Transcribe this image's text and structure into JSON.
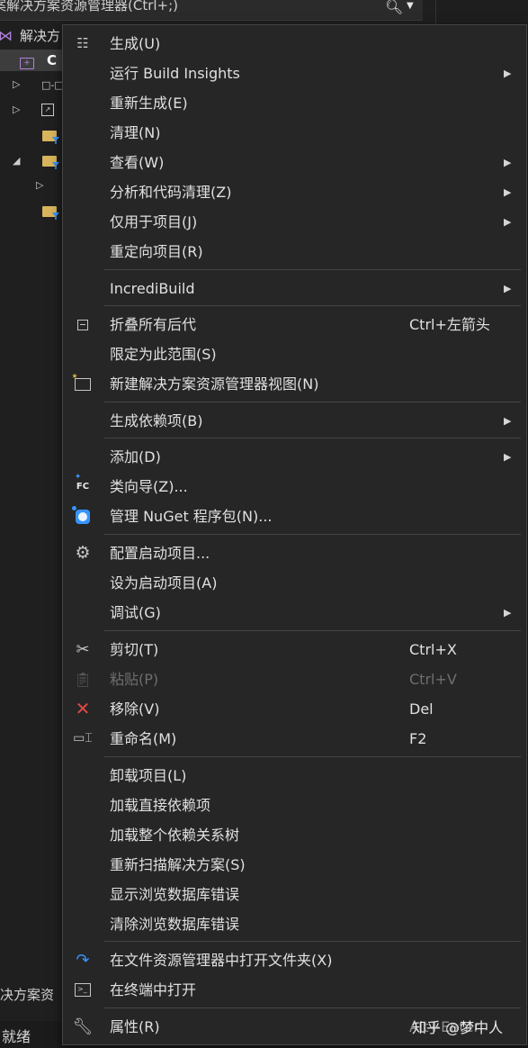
{
  "explorer": {
    "search_text": "案解决方案资源管理器(Ctrl+;)",
    "search_icon": "search-icon",
    "solution_label": "解决方",
    "project_label": "C",
    "bottom_solution_text": "决方案资",
    "status_text": "就绪"
  },
  "watermark": "知乎 @梦中人",
  "menu": {
    "items": [
      {
        "label": "生成(U)",
        "icon": "build-icon",
        "submenu": false,
        "shortcut": ""
      },
      {
        "label": "运行 Build Insights",
        "icon": "",
        "submenu": true,
        "shortcut": ""
      },
      {
        "label": "重新生成(E)",
        "icon": "",
        "submenu": false,
        "shortcut": ""
      },
      {
        "label": "清理(N)",
        "icon": "",
        "submenu": false,
        "shortcut": ""
      },
      {
        "label": "查看(W)",
        "icon": "",
        "submenu": true,
        "shortcut": ""
      },
      {
        "label": "分析和代码清理(Z)",
        "icon": "",
        "submenu": true,
        "shortcut": ""
      },
      {
        "label": "仅用于项目(J)",
        "icon": "",
        "submenu": true,
        "shortcut": ""
      },
      {
        "label": "重定向项目(R)",
        "icon": "",
        "submenu": false,
        "shortcut": ""
      },
      {
        "label": "IncrediBuild",
        "icon": "",
        "submenu": true,
        "shortcut": ""
      },
      {
        "label": "折叠所有后代",
        "icon": "collapse-icon",
        "submenu": false,
        "shortcut": "Ctrl+左箭头"
      },
      {
        "label": "限定为此范围(S)",
        "icon": "",
        "submenu": false,
        "shortcut": ""
      },
      {
        "label": "新建解决方案资源管理器视图(N)",
        "icon": "new-view-icon",
        "submenu": false,
        "shortcut": ""
      },
      {
        "label": "生成依赖项(B)",
        "icon": "",
        "submenu": true,
        "shortcut": ""
      },
      {
        "label": "添加(D)",
        "icon": "",
        "submenu": true,
        "shortcut": ""
      },
      {
        "label": "类向导(Z)...",
        "icon": "class-wizard-icon",
        "submenu": false,
        "shortcut": ""
      },
      {
        "label": "管理 NuGet 程序包(N)...",
        "icon": "nuget-icon",
        "submenu": false,
        "shortcut": ""
      },
      {
        "label": "配置启动项目...",
        "icon": "gear-icon",
        "submenu": false,
        "shortcut": ""
      },
      {
        "label": "设为启动项目(A)",
        "icon": "",
        "submenu": false,
        "shortcut": ""
      },
      {
        "label": "调试(G)",
        "icon": "",
        "submenu": true,
        "shortcut": ""
      },
      {
        "label": "剪切(T)",
        "icon": "cut-icon",
        "submenu": false,
        "shortcut": "Ctrl+X"
      },
      {
        "label": "粘贴(P)",
        "icon": "paste-icon",
        "submenu": false,
        "shortcut": "Ctrl+V",
        "disabled": true
      },
      {
        "label": "移除(V)",
        "icon": "remove-icon",
        "submenu": false,
        "shortcut": "Del"
      },
      {
        "label": "重命名(M)",
        "icon": "rename-icon",
        "submenu": false,
        "shortcut": "F2"
      },
      {
        "label": "卸载项目(L)",
        "icon": "",
        "submenu": false,
        "shortcut": ""
      },
      {
        "label": "加载直接依赖项",
        "icon": "",
        "submenu": false,
        "shortcut": ""
      },
      {
        "label": "加载整个依赖关系树",
        "icon": "",
        "submenu": false,
        "shortcut": ""
      },
      {
        "label": "重新扫描解决方案(S)",
        "icon": "",
        "submenu": false,
        "shortcut": ""
      },
      {
        "label": "显示浏览数据库错误",
        "icon": "",
        "submenu": false,
        "shortcut": ""
      },
      {
        "label": "清除浏览数据库错误",
        "icon": "",
        "submenu": false,
        "shortcut": ""
      },
      {
        "label": "在文件资源管理器中打开文件夹(X)",
        "icon": "open-folder-icon",
        "submenu": false,
        "shortcut": ""
      },
      {
        "label": "在终端中打开",
        "icon": "terminal-icon",
        "submenu": false,
        "shortcut": ""
      },
      {
        "label": "属性(R)",
        "icon": "wrench-icon",
        "submenu": false,
        "shortcut": "Alt+Enter"
      }
    ]
  },
  "colors": {
    "background": "#1f1f1f",
    "menu_background": "#262626",
    "separator": "#454545",
    "text": "#e0e0e0",
    "disabled_text": "#6e6e6e",
    "accent_blue": "#3794ff",
    "vs_purple": "#b180d7",
    "remove_red": "#e04848"
  }
}
